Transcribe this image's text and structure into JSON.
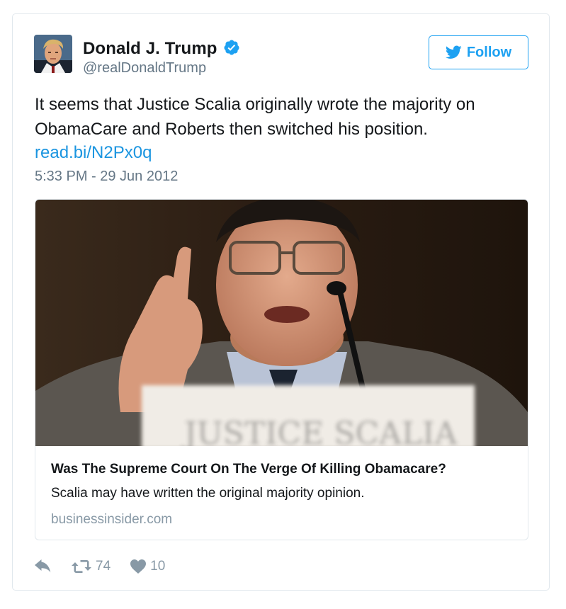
{
  "tweet": {
    "author": {
      "display_name": "Donald J. Trump",
      "handle": "@realDonaldTrump",
      "verified": true,
      "verified_icon": "verified-badge-icon"
    },
    "follow_label": "Follow",
    "text": "It seems that Justice Scalia originally wrote the majority on ObamaCare and Roberts then switched his position.",
    "link_text": "read.bi/N2Px0q",
    "timestamp": "5:33 PM - 29 Jun 2012",
    "card": {
      "title": "Was The Supreme Court On The Verge Of Killing Obamacare?",
      "description": "Scalia may have written the original majority opinion.",
      "domain": "businessinsider.com"
    },
    "actions": {
      "reply_icon": "reply-icon",
      "retweet_icon": "retweet-icon",
      "retweet_count": "74",
      "like_icon": "heart-icon",
      "like_count": "10"
    }
  },
  "colors": {
    "accent": "#1da1f2",
    "link": "#1b95e0",
    "muted": "#657786",
    "border": "#e1e8ed"
  }
}
